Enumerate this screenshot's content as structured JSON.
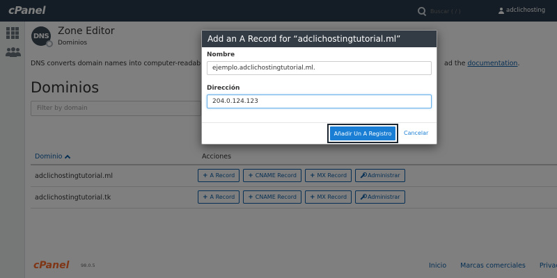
{
  "topbar": {
    "logo": "cPanel",
    "search_placeholder": "Buscar ( / )",
    "username": "adclichosting"
  },
  "sidebar": {
    "items": [
      {
        "icon": "grid-icon"
      },
      {
        "icon": "users-icon"
      }
    ]
  },
  "page": {
    "icon_text": "DNS",
    "title": "Zone Editor",
    "breadcrumb": "Dominios",
    "description_start": "DNS converts domain names into computer-readable IP",
    "description_end_prefix": "ad the ",
    "description_link": "documentation",
    "description_end_suffix": ".",
    "section_title": "Dominios",
    "filter_placeholder": "Filter by domain"
  },
  "table": {
    "col_domain": "Dominio",
    "col_actions": "Acciones",
    "rows": [
      {
        "domain": "adclichostingtutorial.ml"
      },
      {
        "domain": "adclichostingtutorial.tk"
      }
    ],
    "actions": {
      "a_record": "A Record",
      "cname_record": "CNAME Record",
      "mx_record": "MX Record",
      "manage": "Administrar"
    }
  },
  "footer": {
    "logo": "cPanel",
    "version": "98.0.5",
    "links": [
      "Inicio",
      "Marcas comerciales",
      "Privacy"
    ]
  },
  "modal": {
    "title": "Add an A Record for “adclichostingtutorial.ml”",
    "name_label": "Nombre",
    "name_value": "ejemplo.adclichostingtutorial.ml.",
    "address_label": "Dirección",
    "address_value": "204.0.124.123",
    "submit_label": "Añadir Un A Registro",
    "cancel_label": "Cancelar"
  },
  "colors": {
    "topbar": "#293a4a",
    "brand_orange": "#ff6c2c",
    "link_blue": "#0b5ea8",
    "primary_button": "#1a7fd4",
    "modal_header": "#333b44"
  }
}
